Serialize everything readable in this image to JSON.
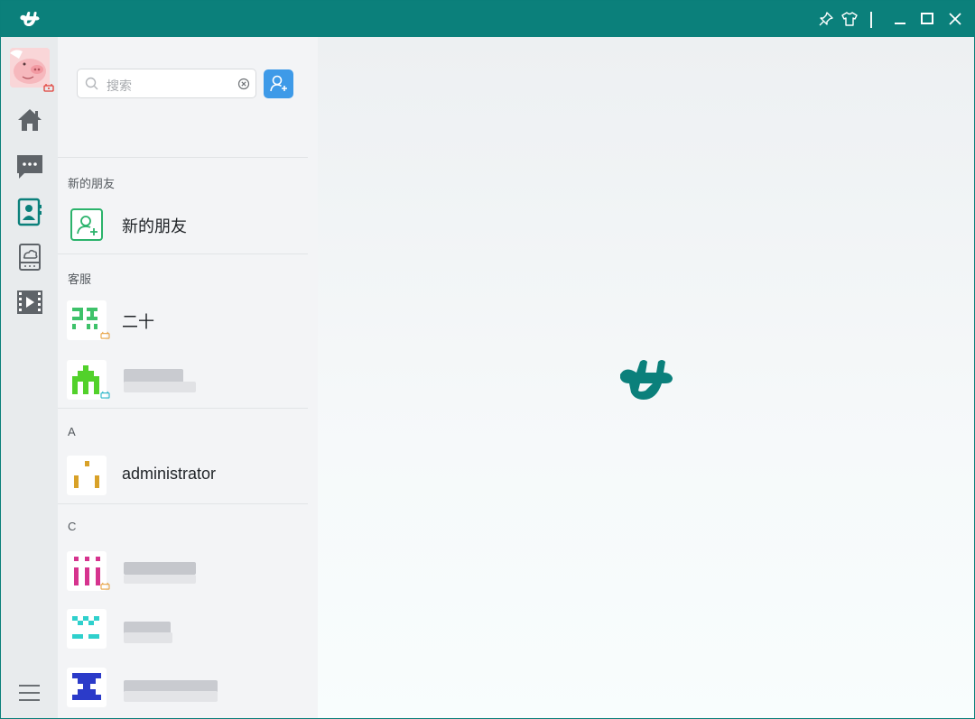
{
  "window": {
    "title_bar": {
      "logo_icon": "app-logo-icon",
      "buttons": [
        "pin-icon",
        "skin-icon",
        "minimize-icon",
        "maximize-icon",
        "close-icon"
      ],
      "color": "#0b807b"
    }
  },
  "sidebar": {
    "nav": [
      "home-icon",
      "chat-icon",
      "contacts-icon",
      "cloud-drive-icon",
      "video-icon"
    ],
    "active": "contacts-icon"
  },
  "contacts": {
    "search_placeholder": "搜索",
    "sections": [
      {
        "label": "新的朋友",
        "items": [
          {
            "name": "新的朋友"
          }
        ]
      },
      {
        "label": "客服",
        "items": [
          {
            "name": "二十"
          },
          {
            "name": ""
          }
        ]
      },
      {
        "label": "A",
        "items": [
          {
            "name": "administrator"
          }
        ]
      },
      {
        "label": "C",
        "items": [
          {
            "name": ""
          },
          {
            "name": ""
          },
          {
            "name": ""
          }
        ]
      }
    ]
  },
  "colors": {
    "accent": "#0b807b",
    "button_blue": "#3e9ae8",
    "new_friend_green": "#2bb36b"
  }
}
